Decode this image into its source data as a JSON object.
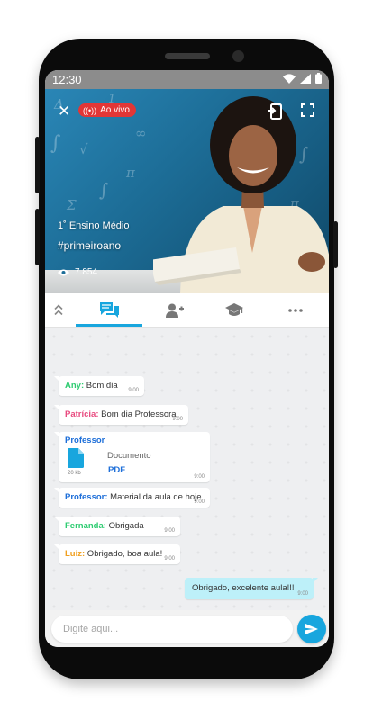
{
  "status_bar": {
    "time": "12:30"
  },
  "video": {
    "live_label": "Ao vivo",
    "course": "1˚ Ensino Médio",
    "hashtag": "#primeiroano",
    "views": "7.854"
  },
  "tabs": [
    {
      "icon": "chat-icon",
      "active": true
    },
    {
      "icon": "add-user-icon",
      "active": false
    },
    {
      "icon": "graduation-cap-icon",
      "active": false
    },
    {
      "icon": "more-icon",
      "active": false
    }
  ],
  "messages": [
    {
      "sender": "Any:",
      "text": " Bom dia",
      "time": "9:00",
      "color": "#2ecc71"
    },
    {
      "sender": "Patrícia:",
      "text": " Bom dia Professora",
      "time": "9:00",
      "color": "#e84a7f"
    },
    {
      "sender": "Professor",
      "doc_size": "20 kb",
      "doc_title": "Documento",
      "doc_type": "PDF",
      "time": "9:00",
      "color": "#1e6fd9"
    },
    {
      "sender": "Professor:",
      "text": " Material da aula de hoje",
      "time": "9:00",
      "color": "#1e6fd9"
    },
    {
      "sender": "Fernanda:",
      "text": " Obrigada",
      "time": "9:00",
      "color": "#2ecc71"
    },
    {
      "sender": "Luiz:",
      "text": " Obrigado, boa aula!",
      "time": "9:00",
      "color": "#f0a020"
    },
    {
      "text": "Obrigado, excelente aula!!!",
      "time": "9:00",
      "outgoing": true
    }
  ],
  "composer": {
    "placeholder": "Digite aqui..."
  },
  "colors": {
    "accent": "#18a6de",
    "live": "#e23636",
    "outgoing_bubble": "#bdf0f9"
  }
}
